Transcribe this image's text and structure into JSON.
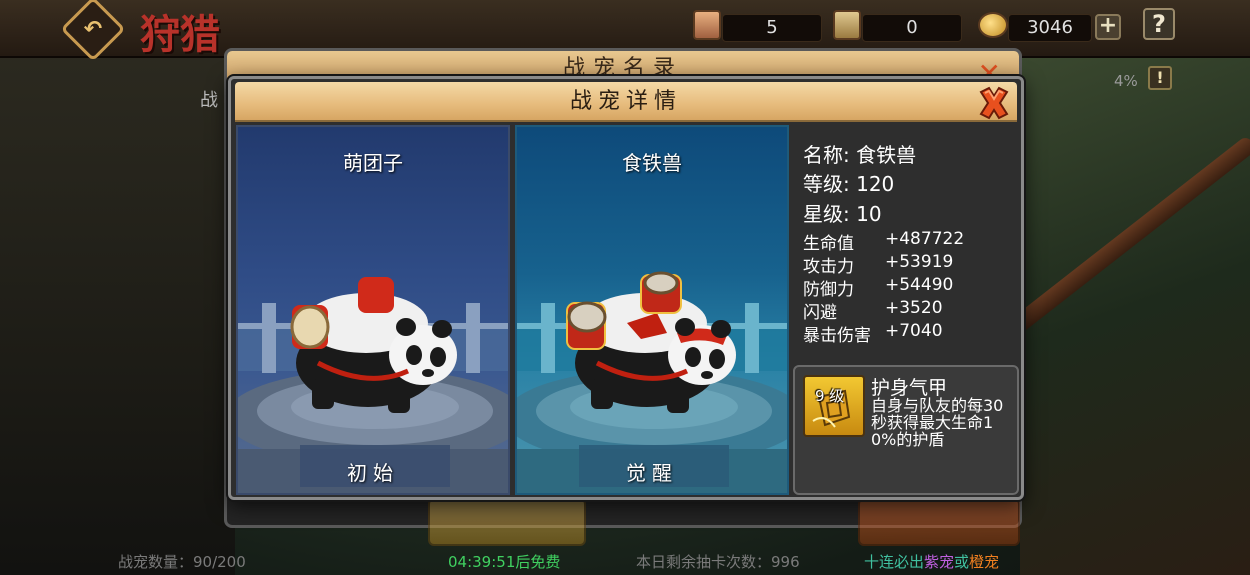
{
  "topbar": {
    "title": "狩猎",
    "resources": [
      {
        "icon": "scroll-ticket-icon",
        "value": "5"
      },
      {
        "icon": "map-ticket-icon",
        "value": "0"
      },
      {
        "icon": "gold-ingot-icon",
        "value": "3046"
      }
    ]
  },
  "background": {
    "panel_title": "战宠名录",
    "side_label": "战",
    "percent": "4%",
    "bottom": {
      "pet_count": "战宠数量：90/200",
      "free_timer": "04:39:51后免费",
      "draws_left": "本日剩余抽卡次数：996",
      "guarantee_prefix": "十连必出",
      "guarantee_purple": "紫宠",
      "guarantee_or": "或",
      "guarantee_orange": "橙宠"
    }
  },
  "dialog": {
    "title": "战宠详情",
    "cards": [
      {
        "name": "萌团子",
        "state": "初始"
      },
      {
        "name": "食铁兽",
        "state": "觉醒"
      }
    ],
    "info": {
      "name_line": "名称: 食铁兽",
      "level_line": "等级: 120",
      "star_line": "星级: 10",
      "stats": [
        {
          "label": "生命值",
          "value": "+487722"
        },
        {
          "label": "攻击力",
          "value": "+53919"
        },
        {
          "label": "防御力",
          "value": "+54490"
        },
        {
          "label": "闪避",
          "value": "+3520"
        },
        {
          "label": "暴击伤害",
          "value": "+7040"
        }
      ]
    },
    "skill": {
      "level": "9 级",
      "name": "护身气甲",
      "description": "自身与队友的每30秒获得最大生命10%的护盾",
      "icon": "shield-armor-icon"
    }
  },
  "colors": {
    "header": "#e6bb7c",
    "close": "#e05020",
    "purple": "#c060e0",
    "orange": "#f08020",
    "timer_green": "#40d060"
  }
}
